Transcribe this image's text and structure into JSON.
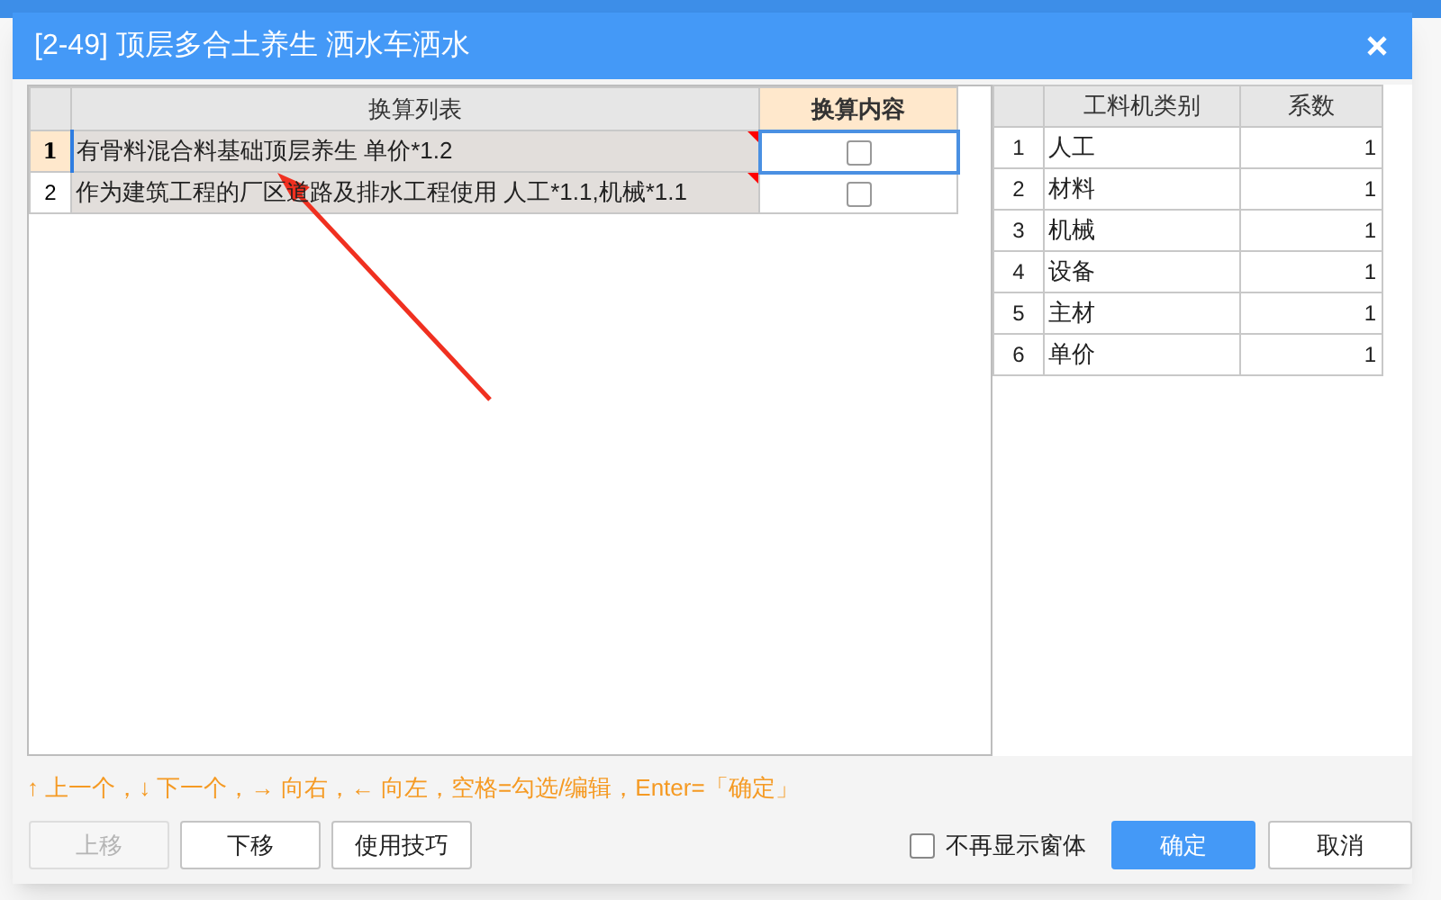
{
  "window": {
    "title": "[2-49] 顶层多合土养生 洒水车洒水"
  },
  "conversion_table": {
    "columns": [
      "换算列表",
      "换算内容"
    ],
    "rows": [
      {
        "index": "1",
        "text": "有骨料混合料基础顶层养生 单价*1.2",
        "checked": false,
        "selected": true
      },
      {
        "index": "2",
        "text": "作为建筑工程的厂区道路及排水工程使用 人工*1.1,机械*1.1",
        "checked": false,
        "selected": false
      }
    ]
  },
  "factor_table": {
    "columns": [
      "工料机类别",
      "系数"
    ],
    "rows": [
      {
        "index": "1",
        "category": "人工",
        "factor": "1"
      },
      {
        "index": "2",
        "category": "材料",
        "factor": "1"
      },
      {
        "index": "3",
        "category": "机械",
        "factor": "1"
      },
      {
        "index": "4",
        "category": "设备",
        "factor": "1"
      },
      {
        "index": "5",
        "category": "主材",
        "factor": "1"
      },
      {
        "index": "6",
        "category": "单价",
        "factor": "1"
      }
    ]
  },
  "hint": "↑ 上一个，↓ 下一个，→ 向右，← 向左，空格=勾选/编辑，Enter=「确定」",
  "buttons": [
    {
      "label": "上移",
      "disabled": true
    },
    {
      "label": "下移",
      "disabled": false
    },
    {
      "label": "使用技巧",
      "disabled": false
    }
  ],
  "dont_show_again": {
    "label": "不再显示窗体",
    "checked": false
  },
  "dialog_buttons": [
    {
      "label": "确定",
      "kind": "primary"
    },
    {
      "label": "取消",
      "kind": "default"
    }
  ]
}
